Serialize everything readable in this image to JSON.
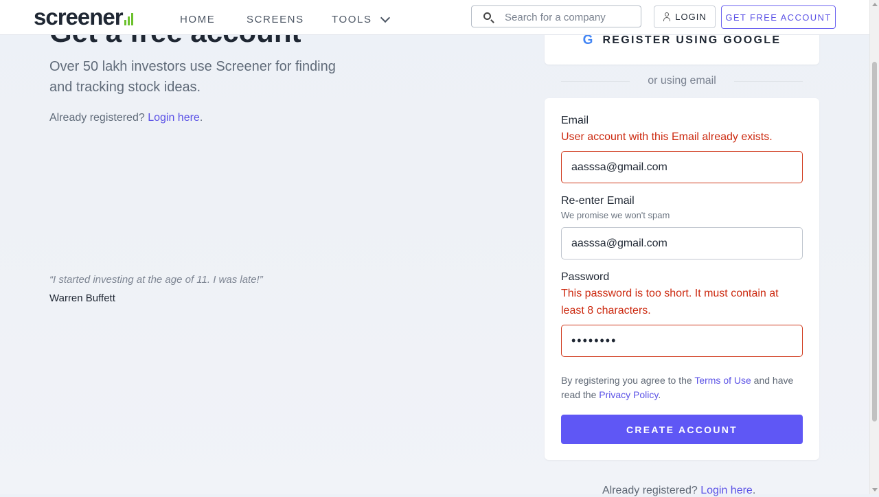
{
  "header": {
    "logo_text": "screener",
    "nav": {
      "home": "HOME",
      "screens": "SCREENS",
      "tools": "TOOLS"
    },
    "search_placeholder": "Search for a company",
    "login_label": "LOGIN",
    "free_account_label": "GET FREE ACCOUNT"
  },
  "intro": {
    "heading": "Get a free account",
    "subtitle": "Over 50 lakh investors use Screener for finding and tracking stock ideas.",
    "already_text": "Already registered?",
    "login_link": "Login here",
    "period": "."
  },
  "quote": {
    "text": "“I started investing at the age of 11. I was late!”",
    "author": "Warren Buffett"
  },
  "google": {
    "icon_glyph": "G",
    "label": "REGISTER USING GOOGLE"
  },
  "divider_text": "or using email",
  "form": {
    "email_label": "Email",
    "email_error": "User account with this Email already exists.",
    "email_value": "aasssa@gmail.com",
    "reenter_label": "Re-enter Email",
    "reenter_hint": "We promise we won't spam",
    "reenter_value": "aasssa@gmail.com",
    "password_label": "Password",
    "password_error": "This password is too short. It must contain at least 8 characters.",
    "password_value": "••••••••",
    "terms_prefix": "By registering you agree to the",
    "terms_link": "Terms of Use",
    "terms_mid": "and have read the",
    "privacy_link": "Privacy Policy",
    "terms_suffix": ".",
    "submit_label": "CREATE ACCOUNT"
  },
  "footer": {
    "already_text": "Already registered?",
    "login_link": "Login here",
    "period": "."
  },
  "colors": {
    "accent": "#5f57f5",
    "error": "#cc2a10",
    "logo_green": "#6cc12d"
  }
}
